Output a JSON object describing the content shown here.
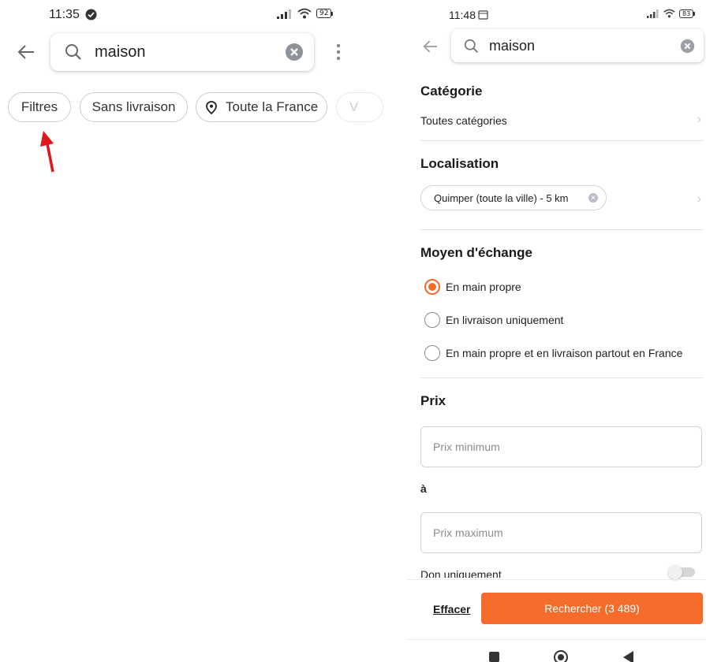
{
  "left": {
    "status_bar": {
      "time": "11:35",
      "battery": "92"
    },
    "search": {
      "query": "maison"
    },
    "chips": [
      {
        "label": "Filtres"
      },
      {
        "label": "Sans livraison"
      },
      {
        "label": "Toute la France"
      },
      {
        "label": "V"
      }
    ],
    "colors": {
      "annotation_arrow": "#e0161d"
    }
  },
  "right": {
    "status_bar": {
      "time": "11:48",
      "battery": "83"
    },
    "search": {
      "query": "maison"
    },
    "category": {
      "title": "Catégorie",
      "value": "Toutes catégories"
    },
    "location": {
      "title": "Localisation",
      "chip": "Quimper (toute la ville) - 5 km"
    },
    "exchange": {
      "title": "Moyen d'échange",
      "options": [
        {
          "label": "En main propre",
          "selected": true
        },
        {
          "label": "En livraison uniquement",
          "selected": false
        },
        {
          "label": "En main propre et en livraison partout en France",
          "selected": false
        }
      ]
    },
    "price": {
      "title": "Prix",
      "min_placeholder": "Prix minimum",
      "separator": "à",
      "max_placeholder": "Prix maximum"
    },
    "donation": {
      "label": "Don uniquement",
      "enabled": false
    },
    "footer": {
      "clear_label": "Effacer",
      "search_label": "Rechercher (3 489)"
    },
    "colors": {
      "accent": "#f56b2a"
    }
  }
}
